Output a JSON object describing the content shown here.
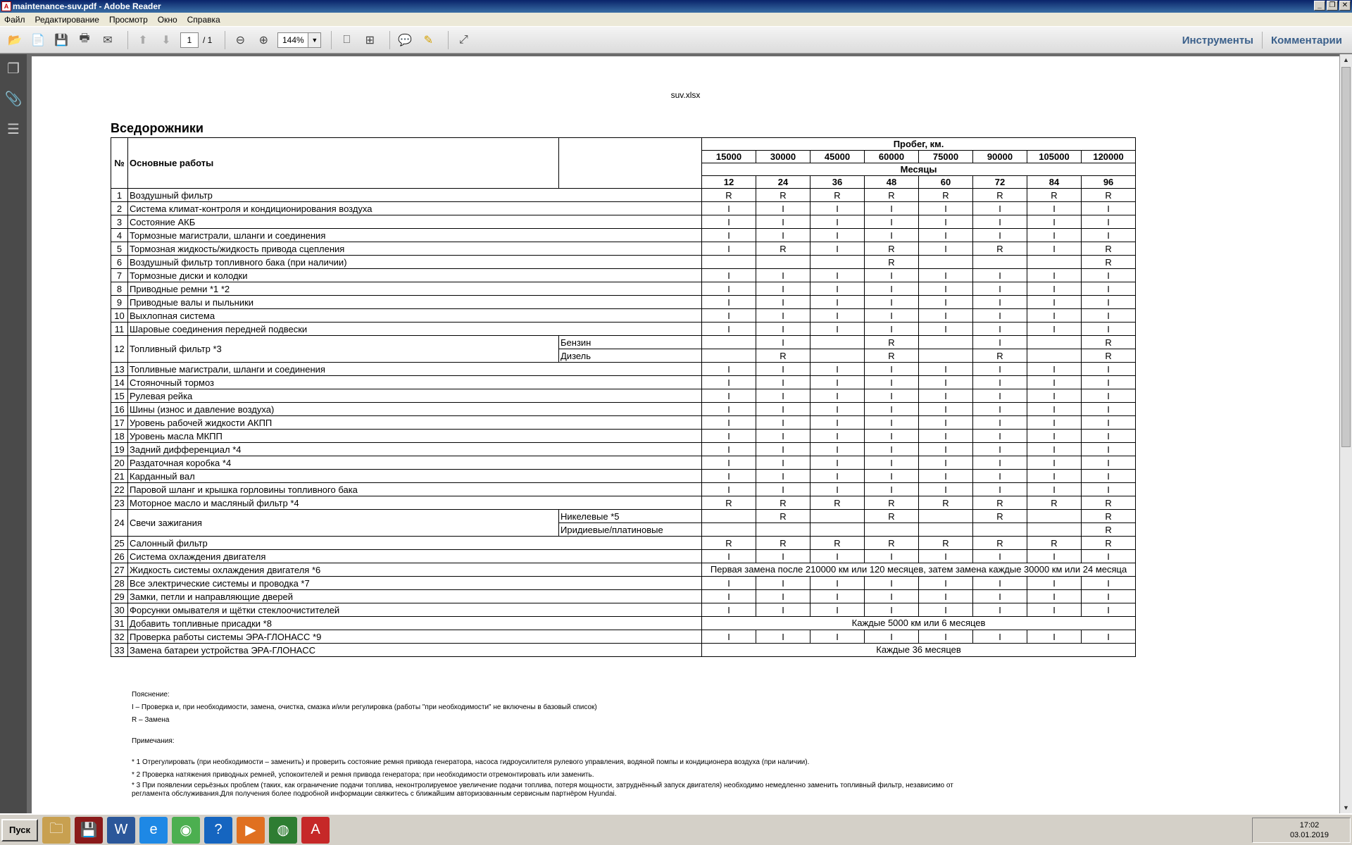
{
  "window": {
    "title": "maintenance-suv.pdf - Adobe Reader"
  },
  "menu": [
    "Файл",
    "Редактирование",
    "Просмотр",
    "Окно",
    "Справка"
  ],
  "toolbar": {
    "page_current": "1",
    "page_total": "/ 1",
    "zoom": "144%",
    "tools": "Инструменты",
    "comments": "Комментарии"
  },
  "document": {
    "header": "suv.xlsx",
    "title": "Вседорожники",
    "col_no": "№",
    "col_work": "Основные работы",
    "mileage_label": "Пробег, км.",
    "months_label": "Месяцы",
    "mileage": [
      "15000",
      "30000",
      "45000",
      "60000",
      "75000",
      "90000",
      "105000",
      "120000"
    ],
    "months": [
      "12",
      "24",
      "36",
      "48",
      "60",
      "72",
      "84",
      "96"
    ],
    "rows": [
      {
        "n": "1",
        "name": "Воздушный фильтр",
        "v": [
          "R",
          "R",
          "R",
          "R",
          "R",
          "R",
          "R",
          "R"
        ]
      },
      {
        "n": "2",
        "name": "Система климат-контроля и кондиционирования воздуха",
        "v": [
          "I",
          "I",
          "I",
          "I",
          "I",
          "I",
          "I",
          "I"
        ]
      },
      {
        "n": "3",
        "name": "Состояние АКБ",
        "v": [
          "I",
          "I",
          "I",
          "I",
          "I",
          "I",
          "I",
          "I"
        ]
      },
      {
        "n": "4",
        "name": "Тормозные магистрали, шланги и соединения",
        "v": [
          "I",
          "I",
          "I",
          "I",
          "I",
          "I",
          "I",
          "I"
        ]
      },
      {
        "n": "5",
        "name": "Тормозная жидкость/жидкость привода сцепления",
        "v": [
          "I",
          "R",
          "I",
          "R",
          "I",
          "R",
          "I",
          "R"
        ]
      },
      {
        "n": "6",
        "name": "Воздушный фильтр топливного бака (при наличии)",
        "v": [
          "",
          "",
          "",
          "R",
          "",
          "",
          "",
          "R"
        ]
      },
      {
        "n": "7",
        "name": "Тормозные диски и колодки",
        "v": [
          "I",
          "I",
          "I",
          "I",
          "I",
          "I",
          "I",
          "I"
        ]
      },
      {
        "n": "8",
        "name": "Приводные ремни *1 *2",
        "v": [
          "I",
          "I",
          "I",
          "I",
          "I",
          "I",
          "I",
          "I"
        ]
      },
      {
        "n": "9",
        "name": "Приводные валы и пыльники",
        "v": [
          "I",
          "I",
          "I",
          "I",
          "I",
          "I",
          "I",
          "I"
        ]
      },
      {
        "n": "10",
        "name": "Выхлопная система",
        "v": [
          "I",
          "I",
          "I",
          "I",
          "I",
          "I",
          "I",
          "I"
        ]
      },
      {
        "n": "11",
        "name": "Шаровые соединения передней подвески",
        "v": [
          "I",
          "I",
          "I",
          "I",
          "I",
          "I",
          "I",
          "I"
        ]
      },
      {
        "n": "12",
        "name": "Топливный фильтр *3",
        "sub": [
          {
            "name": "Бензин",
            "v": [
              "",
              "I",
              "",
              "R",
              "",
              "I",
              "",
              "R"
            ]
          },
          {
            "name": "Дизель",
            "v": [
              "",
              "R",
              "",
              "R",
              "",
              "R",
              "",
              "R"
            ]
          }
        ]
      },
      {
        "n": "13",
        "name": "Топливные магистрали, шланги и соединения",
        "v": [
          "I",
          "I",
          "I",
          "I",
          "I",
          "I",
          "I",
          "I"
        ]
      },
      {
        "n": "14",
        "name": "Стояночный тормоз",
        "v": [
          "I",
          "I",
          "I",
          "I",
          "I",
          "I",
          "I",
          "I"
        ]
      },
      {
        "n": "15",
        "name": "Рулевая рейка",
        "v": [
          "I",
          "I",
          "I",
          "I",
          "I",
          "I",
          "I",
          "I"
        ]
      },
      {
        "n": "16",
        "name": "Шины (износ и давление воздуха)",
        "v": [
          "I",
          "I",
          "I",
          "I",
          "I",
          "I",
          "I",
          "I"
        ]
      },
      {
        "n": "17",
        "name": "Уровень рабочей жидкости АКПП",
        "v": [
          "I",
          "I",
          "I",
          "I",
          "I",
          "I",
          "I",
          "I"
        ]
      },
      {
        "n": "18",
        "name": "Уровень масла МКПП",
        "v": [
          "I",
          "I",
          "I",
          "I",
          "I",
          "I",
          "I",
          "I"
        ]
      },
      {
        "n": "19",
        "name": "Задний дифференциал *4",
        "v": [
          "I",
          "I",
          "I",
          "I",
          "I",
          "I",
          "I",
          "I"
        ]
      },
      {
        "n": "20",
        "name": "Раздаточная коробка *4",
        "v": [
          "I",
          "I",
          "I",
          "I",
          "I",
          "I",
          "I",
          "I"
        ]
      },
      {
        "n": "21",
        "name": "Карданный вал",
        "v": [
          "I",
          "I",
          "I",
          "I",
          "I",
          "I",
          "I",
          "I"
        ]
      },
      {
        "n": "22",
        "name": "Паровой шланг и крышка горловины топливного бака",
        "v": [
          "I",
          "I",
          "I",
          "I",
          "I",
          "I",
          "I",
          "I"
        ]
      },
      {
        "n": "23",
        "name": "Моторное масло и масляный фильтр *4",
        "v": [
          "R",
          "R",
          "R",
          "R",
          "R",
          "R",
          "R",
          "R"
        ]
      },
      {
        "n": "24",
        "name": "Свечи зажигания",
        "sub": [
          {
            "name": "Никелевые *5",
            "v": [
              "",
              "R",
              "",
              "R",
              "",
              "R",
              "",
              "R"
            ]
          },
          {
            "name": "Иридиевые/платиновые",
            "v": [
              "",
              "",
              "",
              "",
              "",
              "",
              "",
              "R"
            ]
          }
        ]
      },
      {
        "n": "25",
        "name": "Салонный фильтр",
        "v": [
          "R",
          "R",
          "R",
          "R",
          "R",
          "R",
          "R",
          "R"
        ]
      },
      {
        "n": "26",
        "name": "Система охлаждения двигателя",
        "v": [
          "I",
          "I",
          "I",
          "I",
          "I",
          "I",
          "I",
          "I"
        ]
      },
      {
        "n": "27",
        "name": "Жидкость системы охлаждения двигателя *6",
        "span": "Первая замена после 210000 км или 120 месяцев, затем замена каждые 30000 км или 24 месяца"
      },
      {
        "n": "28",
        "name": "Все электрические системы и проводка *7",
        "v": [
          "I",
          "I",
          "I",
          "I",
          "I",
          "I",
          "I",
          "I"
        ]
      },
      {
        "n": "29",
        "name": "Замки, петли и направляющие дверей",
        "v": [
          "I",
          "I",
          "I",
          "I",
          "I",
          "I",
          "I",
          "I"
        ]
      },
      {
        "n": "30",
        "name": "Форсунки омывателя и щётки стеклоочистителей",
        "v": [
          "I",
          "I",
          "I",
          "I",
          "I",
          "I",
          "I",
          "I"
        ]
      },
      {
        "n": "31",
        "name": "Добавить топливные присадки *8",
        "span": "Каждые 5000 км или 6 месяцев"
      },
      {
        "n": "32",
        "name": "Проверка работы системы ЭРА-ГЛОНАСС *9",
        "v": [
          "I",
          "I",
          "I",
          "I",
          "I",
          "I",
          "I",
          "I"
        ]
      },
      {
        "n": "33",
        "name": "Замена батареи устройства ЭРА-ГЛОНАСС",
        "span": "Каждые 36 месяцев"
      }
    ],
    "notes": [
      "Пояснение:",
      "I – Проверка и, при необходимости, замена, очистка, смазка и/или регулировка (работы \"при необходимости\" не включены в базовый список)",
      "R – Замена",
      "",
      "Примечания:",
      "",
      "* 1 Отрегулировать (при необходимости – заменить) и проверить состояние ремня привода генератора, насоса гидроусилителя рулевого управления, водяной помпы и кондиционера воздуха (при наличии).",
      "* 2 Проверка натяжения приводных ремней, успокоителей и ремня привода генератора; при необходимости отремонтировать или заменить.",
      "* 3 При появлении серьёзных проблем (таких, как ограничение подачи топлива, неконтролируемое увеличение подачи топлива, потеря мощности, затруднённый запуск двигателя) необходимо немедленно заменить топливный фильтр, независимо от регламента обслуживания.Для получения более подробной информации свяжитесь с ближайшим авторизованным сервисным партнёром Hyundai."
    ]
  },
  "taskbar": {
    "start": "Пуск",
    "time": "17:02",
    "date": "03.01.2019"
  }
}
